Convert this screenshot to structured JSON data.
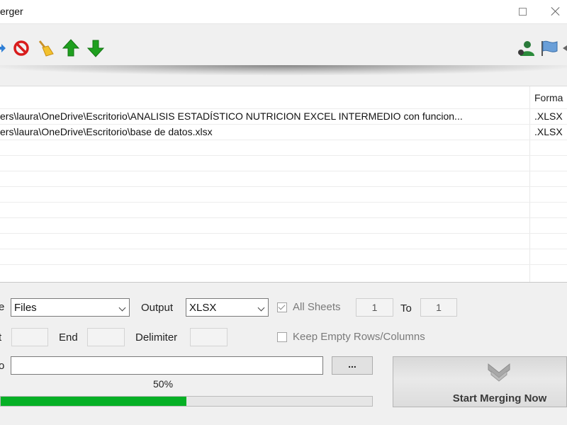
{
  "window": {
    "title": "erger"
  },
  "toolbar": {
    "icons": [
      "blue-arrow-icon",
      "remove-icon",
      "broom-icon",
      "move-up-icon",
      "move-down-icon",
      "user-icon",
      "flag-icon"
    ]
  },
  "file_list": {
    "column_header_format": "Forma",
    "rows": [
      {
        "path": "ers\\laura\\OneDrive\\Escritorio\\ANALISIS ESTADÍSTICO NUTRICION EXCEL INTERMEDIO con funcion...",
        "format": ".XLSX"
      },
      {
        "path": "ers\\laura\\OneDrive\\Escritorio\\base de datos.xlsx",
        "format": ".XLSX"
      }
    ]
  },
  "options": {
    "mode_label_fragment": "e",
    "mode_value": "Files",
    "output_label": "Output",
    "output_value": "XLSX",
    "all_sheets_label": "All Sheets",
    "all_sheets_checked": true,
    "sheet_from": "1",
    "to_label": "To",
    "sheet_to": "1",
    "start_label_fragment": "t",
    "end_label": "End",
    "delimiter_label": "Delimiter",
    "keep_empty_label": "Keep Empty Rows/Columns",
    "keep_empty_checked": false,
    "save_to_label_fragment": "o",
    "browse_label": "..."
  },
  "progress": {
    "text": "50%",
    "value_percent": 50
  },
  "start_button": {
    "label": "Start Merging Now",
    "icon": "merge-arrows-icon"
  },
  "colors": {
    "progress_fill": "#06b025",
    "toolbar_arrow_green": "#1fa01f",
    "remove_red": "#d81c1c"
  }
}
